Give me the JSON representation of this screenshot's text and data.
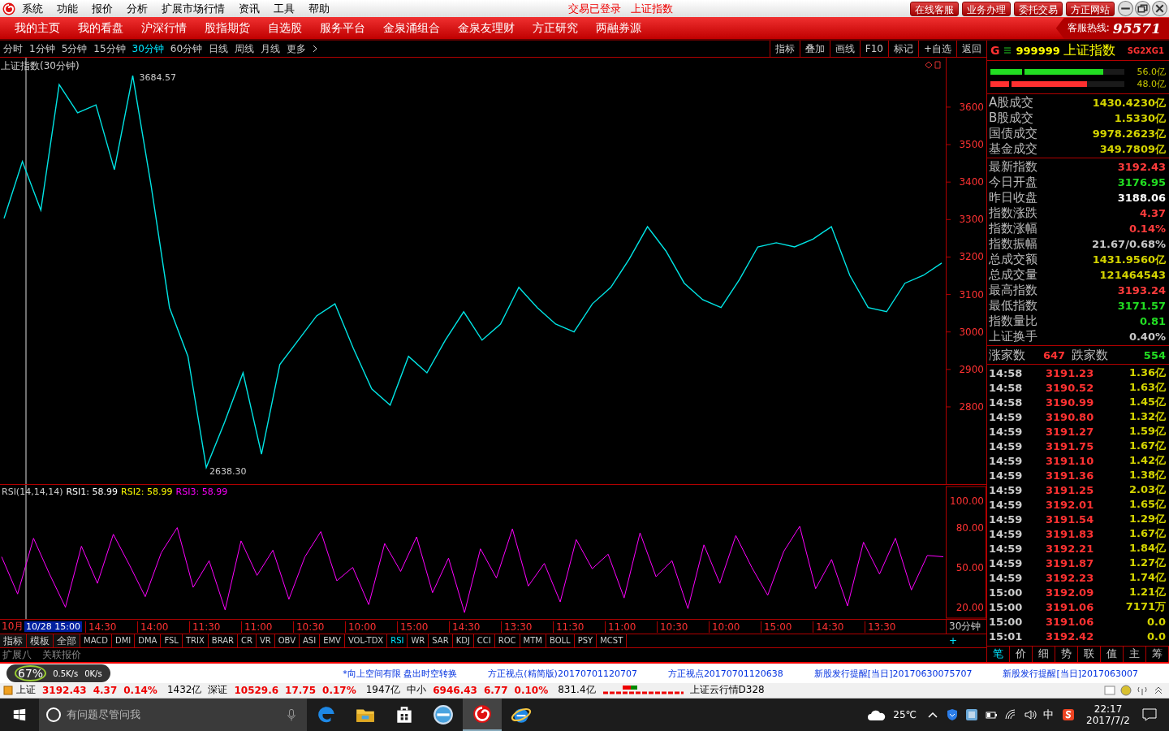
{
  "menu_bar": {
    "items": [
      "系统",
      "功能",
      "报价",
      "分析",
      "扩展市场行情",
      "资讯",
      "工具",
      "帮助"
    ],
    "login_status": "交易已登录",
    "current_security": "上证指数",
    "buttons": [
      "在线客服",
      "业务办理",
      "委托交易",
      "方正网站"
    ]
  },
  "nav_bar": {
    "items": [
      "我的主页",
      "我的看盘",
      "沪深行情",
      "股指期货",
      "自选股",
      "服务平台",
      "金泉涌组合",
      "金泉友理财",
      "方正研究",
      "两融券源"
    ],
    "hotline_label": "客服热线:",
    "hotline_number": "95571"
  },
  "period_bar": {
    "periods": [
      {
        "label": "分时",
        "selected": false
      },
      {
        "label": "1分钟",
        "selected": false
      },
      {
        "label": "5分钟",
        "selected": false
      },
      {
        "label": "15分钟",
        "selected": false
      },
      {
        "label": "30分钟",
        "selected": true
      },
      {
        "label": "60分钟",
        "selected": false
      },
      {
        "label": "日线",
        "selected": false
      },
      {
        "label": "周线",
        "selected": false
      },
      {
        "label": "月线",
        "selected": false
      }
    ],
    "more": "更多",
    "tools": [
      "指标",
      "叠加",
      "画线",
      "F10",
      "标记",
      "+自选",
      "返回"
    ]
  },
  "price_chart": {
    "title": "上证指数(30分钟)",
    "high_mark": "3684.57",
    "low_mark": "2638.30",
    "chart_data": {
      "type": "line",
      "ylim": [
        2594,
        3732
      ],
      "yticks": [
        2800,
        2900,
        3000,
        3100,
        3200,
        3300,
        3400,
        3500,
        3600
      ],
      "series": [
        {
          "color": "#00e5e5",
          "values": [
            3303,
            3455,
            3325,
            3660,
            3585,
            3606,
            3433,
            3684,
            3390,
            3065,
            2935,
            2638,
            2760,
            2891,
            2674,
            2913,
            2978,
            3043,
            3075,
            2956,
            2848,
            2805,
            2935,
            2891,
            2978,
            3054,
            2978,
            3021,
            3119,
            3065,
            3021,
            3000,
            3075,
            3119,
            3194,
            3281,
            3216,
            3130,
            3086,
            3065,
            3140,
            3227,
            3238,
            3227,
            3248,
            3281,
            3151,
            3065,
            3054,
            3130,
            3151,
            3184
          ]
        }
      ]
    }
  },
  "rsi_panel": {
    "name": "RSI(14,14,14)",
    "series": [
      {
        "label": "RSI1: 58.99",
        "color": "#ffffff"
      },
      {
        "label": "RSI2: 58.99",
        "color": "#ffff00"
      },
      {
        "label": "RSI3: 58.99",
        "color": "#ff00ff"
      }
    ],
    "chart_data": {
      "type": "line",
      "ylim": [
        11.2,
        112.2
      ],
      "yticks": [
        {
          "value": 100,
          "label": "100.00"
        },
        {
          "value": 80,
          "label": "80.00"
        },
        {
          "value": 50,
          "label": "50.00"
        },
        {
          "value": 20,
          "label": "20.00"
        }
      ],
      "series": [
        {
          "color": "#ff00ff",
          "values": [
            58,
            30,
            72,
            45,
            20,
            66,
            38,
            75,
            52,
            28,
            61,
            80,
            35,
            55,
            18,
            70,
            44,
            63,
            26,
            58,
            77,
            40,
            50,
            22,
            68,
            47,
            73,
            31,
            57,
            16,
            64,
            42,
            79,
            36,
            53,
            24,
            71,
            49,
            60,
            27,
            76,
            43,
            55,
            19,
            67,
            38,
            74,
            50,
            29,
            62,
            81,
            34,
            56,
            21,
            69,
            45,
            72,
            33,
            59,
            58
          ]
        }
      ]
    }
  },
  "time_axis": {
    "month": "10月",
    "cursor_time": "10/28 15:00",
    "labels": [
      "14:30",
      "14:00",
      "11:30",
      "11:00",
      "10:30",
      "10:00",
      "15:00",
      "14:30",
      "13:30",
      "11:30",
      "11:00",
      "10:30",
      "10:00",
      "15:00",
      "14:30",
      "13:30"
    ],
    "period": "30分钟",
    "add": "+"
  },
  "indicator_tabs": [
    {
      "label": "指标",
      "selected": false
    },
    {
      "label": "模板",
      "selected": false
    },
    {
      "label": "全部",
      "selected": false
    },
    {
      "label": "MACD",
      "selected": false
    },
    {
      "label": "DMI",
      "selected": false
    },
    {
      "label": "DMA",
      "selected": false
    },
    {
      "label": "FSL",
      "selected": false
    },
    {
      "label": "TRIX",
      "selected": false
    },
    {
      "label": "BRAR",
      "selected": false
    },
    {
      "label": "CR",
      "selected": false
    },
    {
      "label": "VR",
      "selected": false
    },
    {
      "label": "OBV",
      "selected": false
    },
    {
      "label": "ASI",
      "selected": false
    },
    {
      "label": "EMV",
      "selected": false
    },
    {
      "label": "VOL-TDX",
      "selected": false
    },
    {
      "label": "RSI",
      "selected": true
    },
    {
      "label": "WR",
      "selected": false
    },
    {
      "label": "SAR",
      "selected": false
    },
    {
      "label": "KDJ",
      "selected": false
    },
    {
      "label": "CCI",
      "selected": false
    },
    {
      "label": "ROC",
      "selected": false
    },
    {
      "label": "MTM",
      "selected": false
    },
    {
      "label": "BOLL",
      "selected": false
    },
    {
      "label": "PSY",
      "selected": false
    },
    {
      "label": "MCST",
      "selected": false
    }
  ],
  "extension_tabs": [
    "扩展八",
    "关联报价"
  ],
  "network_monitor": {
    "percent": "67%",
    "upload": "0.5K/s",
    "download": "0K/s"
  },
  "ticker": [
    "*向上空间有限 盘出时空转换",
    "方正视点(精简版)20170701120707",
    "方正视点20170701120638",
    "新股发行提醒[当日]20170630075707",
    "新股发行提醒[当日]2017063007"
  ],
  "status_bar": {
    "indices": [
      {
        "name": "上证",
        "value": "3192.43",
        "change": "4.37",
        "percent": "0.14%",
        "turnover": "1432亿"
      },
      {
        "name": "深证",
        "value": "10529.6",
        "change": "17.75",
        "percent": "0.17%",
        "turnover": "1947亿"
      },
      {
        "name": "中小",
        "value": "6946.43",
        "change": "6.77",
        "percent": "0.10%",
        "turnover": "831.4亿"
      }
    ],
    "service": "上证云行情D328"
  },
  "right_panel": {
    "marker": "G",
    "code": "999999",
    "name": "上证指数",
    "flags": "SG2XG1",
    "buy_bar": {
      "level": 0.84,
      "value": "56.0亿"
    },
    "sell_bar": {
      "level": 0.72,
      "value": "48.0亿"
    },
    "turnover": [
      {
        "label": "A股成交",
        "value": "1430.4230亿"
      },
      {
        "label": "B股成交",
        "value": "1.5330亿"
      },
      {
        "label": "国债成交",
        "value": "9978.2623亿"
      },
      {
        "label": "基金成交",
        "value": "349.7809亿"
      }
    ],
    "stats": [
      {
        "label": "最新指数",
        "value": "3192.43",
        "color": "#ff3c3c"
      },
      {
        "label": "今日开盘",
        "value": "3176.95",
        "color": "#22dd22"
      },
      {
        "label": "昨日收盘",
        "value": "3188.06",
        "color": "#ffffff"
      },
      {
        "label": "指数涨跌",
        "value": "4.37",
        "color": "#ff3c3c"
      },
      {
        "label": "指数涨幅",
        "value": "0.14%",
        "color": "#ff3c3c"
      },
      {
        "label": "指数振幅",
        "value": "21.67/0.68%",
        "color": "#c8c8c8"
      },
      {
        "label": "总成交额",
        "value": "1431.9560亿",
        "color": "#d4d400"
      },
      {
        "label": "总成交量",
        "value": "121464543",
        "color": "#d4d400"
      },
      {
        "label": "最高指数",
        "value": "3193.24",
        "color": "#ff3c3c"
      },
      {
        "label": "最低指数",
        "value": "3171.57",
        "color": "#22dd22"
      },
      {
        "label": "指数量比",
        "value": "0.81",
        "color": "#22dd22"
      },
      {
        "label": "上证换手",
        "value": "0.40%",
        "color": "#c8c8c8"
      }
    ],
    "advancers_label": "涨家数",
    "advancers": "647",
    "decliners_label": "跌家数",
    "decliners": "554",
    "ticks": [
      {
        "time": "14:58",
        "price": "3191.23",
        "volume": "1.36亿"
      },
      {
        "time": "14:58",
        "price": "3190.52",
        "volume": "1.63亿"
      },
      {
        "time": "14:58",
        "price": "3190.99",
        "volume": "1.45亿"
      },
      {
        "time": "14:59",
        "price": "3190.80",
        "volume": "1.32亿"
      },
      {
        "time": "14:59",
        "price": "3191.27",
        "volume": "1.59亿"
      },
      {
        "time": "14:59",
        "price": "3191.75",
        "volume": "1.67亿"
      },
      {
        "time": "14:59",
        "price": "3191.10",
        "volume": "1.42亿"
      },
      {
        "time": "14:59",
        "price": "3191.36",
        "volume": "1.38亿"
      },
      {
        "time": "14:59",
        "price": "3191.25",
        "volume": "2.03亿"
      },
      {
        "time": "14:59",
        "price": "3192.01",
        "volume": "1.65亿"
      },
      {
        "time": "14:59",
        "price": "3191.54",
        "volume": "1.29亿"
      },
      {
        "time": "14:59",
        "price": "3191.83",
        "volume": "1.67亿"
      },
      {
        "time": "14:59",
        "price": "3192.21",
        "volume": "1.84亿"
      },
      {
        "time": "14:59",
        "price": "3191.87",
        "volume": "1.27亿"
      },
      {
        "time": "14:59",
        "price": "3192.23",
        "volume": "1.74亿"
      },
      {
        "time": "15:00",
        "price": "3192.09",
        "volume": "1.21亿"
      },
      {
        "time": "15:00",
        "price": "3191.06",
        "volume": "7171万"
      },
      {
        "time": "15:00",
        "price": "3191.06",
        "volume": "0.0"
      },
      {
        "time": "15:01",
        "price": "3192.42",
        "volume": "0.0"
      }
    ],
    "tabs": [
      {
        "label": "笔",
        "selected": true
      },
      {
        "label": "价",
        "selected": false
      },
      {
        "label": "细",
        "selected": false
      },
      {
        "label": "势",
        "selected": false
      },
      {
        "label": "联",
        "selected": false
      },
      {
        "label": "值",
        "selected": false
      },
      {
        "label": "主",
        "selected": false
      },
      {
        "label": "筹",
        "selected": false
      }
    ]
  },
  "taskbar": {
    "search_placeholder": "有问题尽管问我",
    "apps": [
      {
        "kind": "edge",
        "selected": false
      },
      {
        "kind": "folder",
        "selected": false
      },
      {
        "kind": "store",
        "selected": false
      },
      {
        "kind": "browser",
        "selected": false
      },
      {
        "kind": "swirl",
        "selected": true
      },
      {
        "kind": "ie",
        "selected": false
      }
    ],
    "weather": "25℃",
    "ime": "中",
    "time": "22:17",
    "date": "2017/7/2"
  }
}
